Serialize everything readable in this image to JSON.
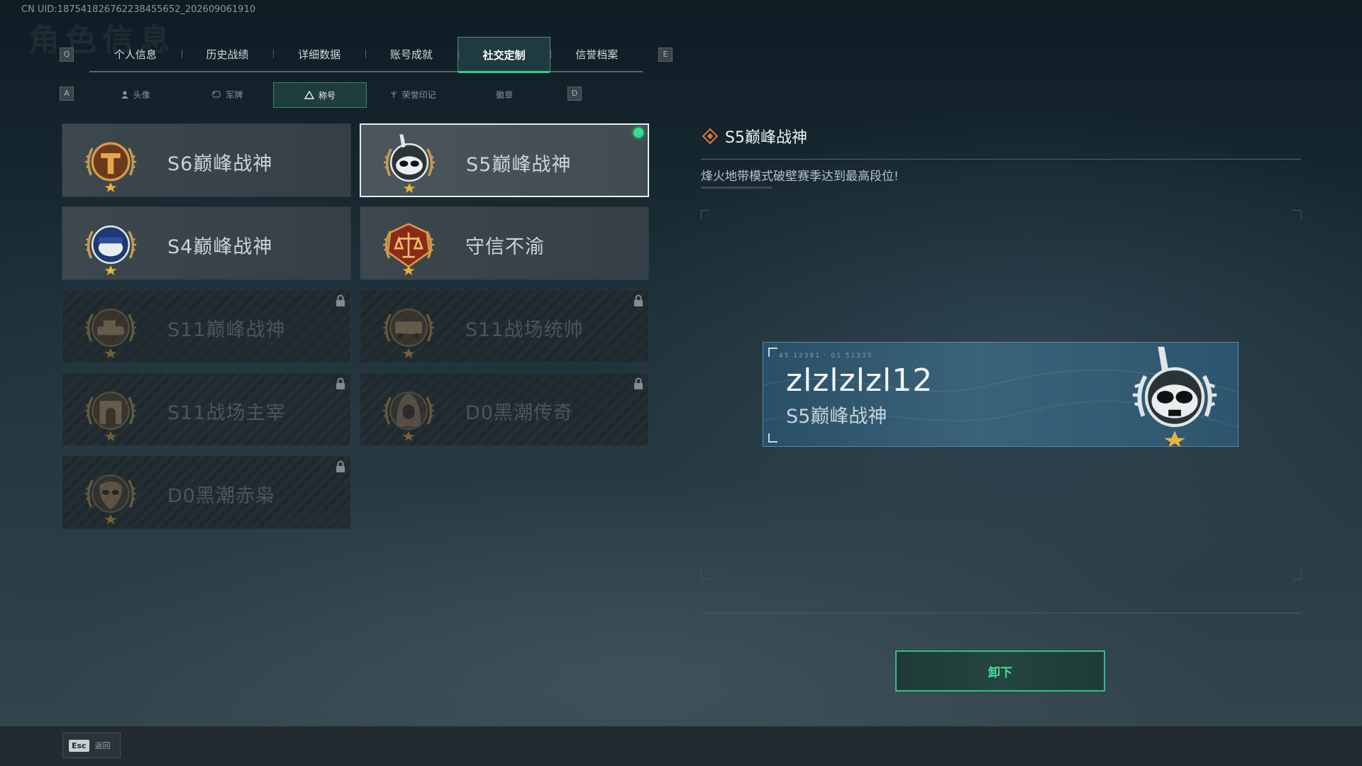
{
  "uid_text": "CN UID:187541826762238455652_202609061910",
  "tabs": {
    "prev_key": "Q",
    "next_key": "E",
    "items": [
      {
        "label": "个人信息"
      },
      {
        "label": "历史战绩"
      },
      {
        "label": "详细数据"
      },
      {
        "label": "账号成就"
      },
      {
        "label": "社交定制",
        "active": true
      },
      {
        "label": "信誉档案"
      }
    ]
  },
  "subtabs": {
    "prev_key": "A",
    "next_key": "D",
    "items": [
      {
        "label": "头像",
        "icon": "person-icon"
      },
      {
        "label": "军牌",
        "icon": "dogtag-icon"
      },
      {
        "label": "称号",
        "icon": "triangle-icon",
        "active": true
      },
      {
        "label": "荣誉印记",
        "icon": "honor-mark-icon"
      },
      {
        "label": "徽章",
        "icon": ""
      }
    ]
  },
  "titles": [
    {
      "name": "S6巅峰战神",
      "emblem": "s6-emblem",
      "locked": false,
      "selected": false
    },
    {
      "name": "S5巅峰战神",
      "emblem": "s5-emblem",
      "locked": false,
      "selected": true,
      "equipped": true
    },
    {
      "name": "S4巅峰战神",
      "emblem": "s4-emblem",
      "locked": false,
      "selected": false
    },
    {
      "name": "守信不渝",
      "emblem": "scales-emblem",
      "locked": false,
      "selected": false
    },
    {
      "name": "S11巅峰战神",
      "emblem": "s11-tank-emblem",
      "locked": true
    },
    {
      "name": "S11战场统帅",
      "emblem": "s11-vehicle-emblem",
      "locked": true
    },
    {
      "name": "S11战场主宰",
      "emblem": "s11-arch-emblem",
      "locked": true
    },
    {
      "name": "D0黑潮传奇",
      "emblem": "d0-hood-emblem",
      "locked": true
    },
    {
      "name": "D0黑潮赤枭",
      "emblem": "d0-mask-emblem",
      "locked": true
    }
  ],
  "detail": {
    "title": "S5巅峰战神",
    "description": "烽火地带模式破壁赛季达到最高段位!"
  },
  "preview": {
    "player_name": "zlzlzlzl12",
    "title": "S5巅峰战神"
  },
  "actions": {
    "unequip_label": "卸下"
  },
  "footer": {
    "esc_key": "Esc",
    "back_label": "返回"
  },
  "colors": {
    "accent_green": "#2fd08d",
    "equipped_dot": "#30e28f"
  }
}
